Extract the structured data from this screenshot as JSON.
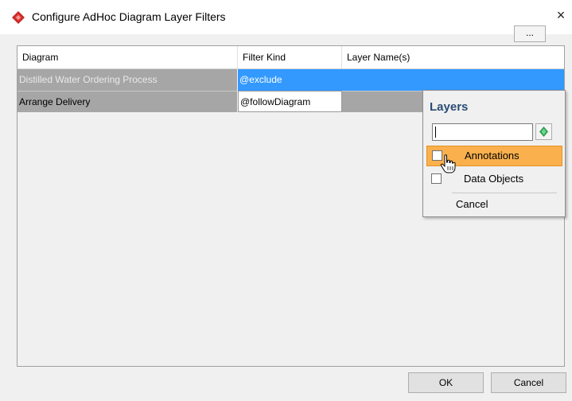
{
  "window": {
    "title": "Configure AdHoc Diagram Layer Filters",
    "close_glyph": "×"
  },
  "table": {
    "columns": [
      "Diagram",
      "Filter Kind",
      "Layer Name(s)"
    ],
    "rows": [
      {
        "diagram": "Distilled Water Ordering Process",
        "filter_kind": "@exclude",
        "layer_names": ""
      },
      {
        "diagram": "Arrange Delivery",
        "filter_kind": "@followDiagram",
        "layer_names": ""
      }
    ],
    "ellipsis_label": "..."
  },
  "layers_popup": {
    "title": "Layers",
    "search_value": "",
    "items": [
      {
        "label": "Annotations",
        "checked": false,
        "highlighted": true
      },
      {
        "label": "Data Objects",
        "checked": false,
        "highlighted": false
      }
    ],
    "cancel_label": "Cancel"
  },
  "footer": {
    "ok_label": "OK",
    "cancel_label": "Cancel"
  },
  "icons": {
    "app": "visual-paradigm-diamond-icon",
    "search_button": "green-diamond-icon",
    "cursor": "hand-pointer-icon"
  },
  "colors": {
    "selection": "#3399ff",
    "highlight": "#f9b04d",
    "popup_title": "#2a4d73",
    "row_bg": "#a6a6a6"
  }
}
